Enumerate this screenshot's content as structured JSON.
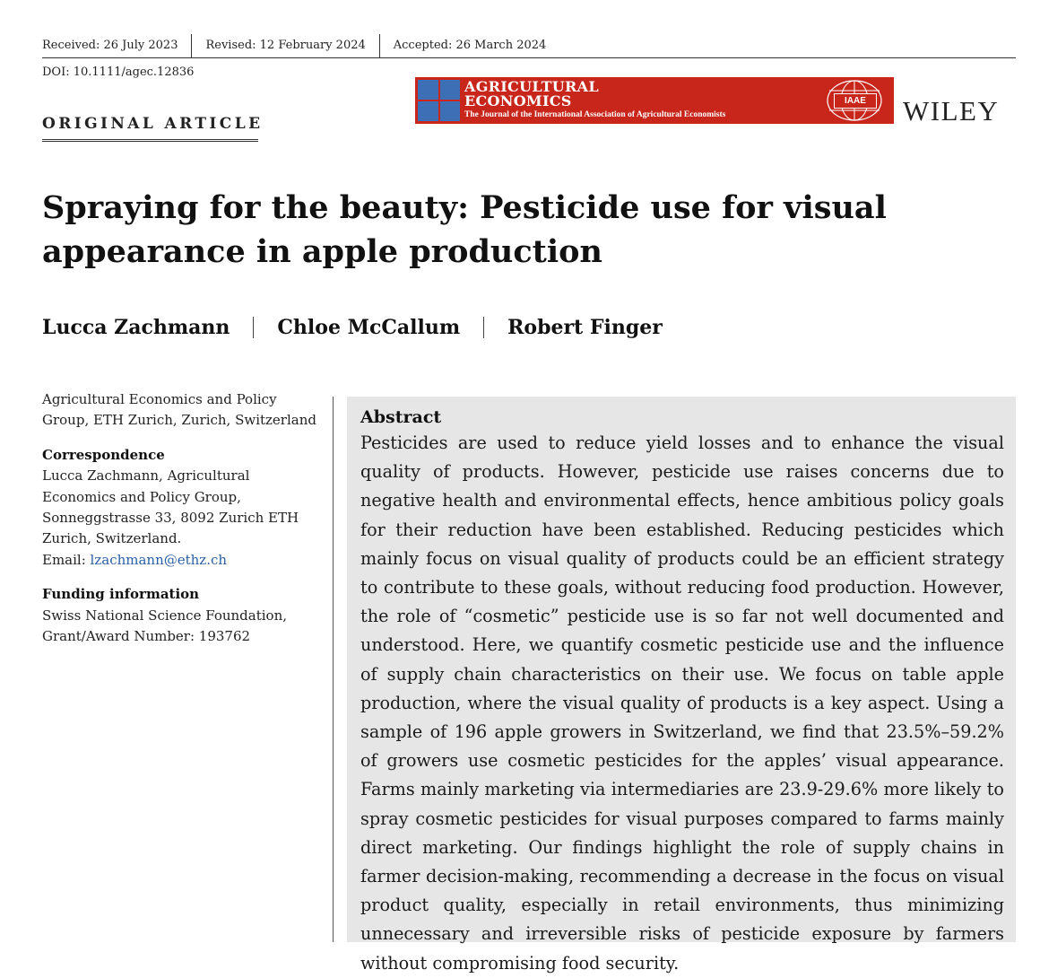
{
  "header": {
    "dates": [
      "Received: 26 July 2023",
      "Revised: 12 February 2024",
      "Accepted: 26 March 2024"
    ],
    "doi": "DOI: 10.1111/agec.12836",
    "article_type": "ORIGINAL ARTICLE"
  },
  "journal": {
    "name_line1": "AGRICULTURAL",
    "name_line2": "ECONOMICS",
    "subtitle": "The Journal of the International Association of Agricultural Economists",
    "badge": "IAAE",
    "publisher": "WILEY",
    "colors": {
      "banner": "#c8251b",
      "logo_squares": "#3c6fb6"
    }
  },
  "title": "Spraying for the beauty: Pesticide use for visual appearance in apple production",
  "authors": [
    "Lucca Zachmann",
    "Chloe McCallum",
    "Robert Finger"
  ],
  "sidebar": {
    "affiliation": "Agricultural Economics and Policy Group, ETH Zurich, Zurich, Switzerland",
    "correspondence_heading": "Correspondence",
    "correspondence_text": "Lucca Zachmann, Agricultural Economics and Policy Group, Sonneggstrasse 33, 8092 Zurich ETH Zurich, Switzerland.",
    "email_label": "Email: ",
    "email": "lzachmann@ethz.ch",
    "funding_heading": "Funding information",
    "funding_text": "Swiss National Science Foundation, Grant/Award Number: 193762"
  },
  "abstract": {
    "heading": "Abstract",
    "text": "Pesticides are used to reduce yield losses and to enhance the visual quality of products. However, pesticide use raises concerns due to negative health and environmental effects, hence ambitious policy goals for their reduction have been established. Reducing pesticides which mainly focus on visual quality of products could be an efficient strategy to contribute to these goals, without reducing food production. However, the role of “cosmetic” pesticide use is so far not well documented and understood. Here, we quantify cosmetic pesticide use and the influence of supply chain characteristics on their use. We focus on table apple production, where the visual quality of products is a key aspect. Using a sample of 196 apple growers in Switzerland, we find that 23.5%–59.2% of growers use cosmetic pesticides for the apples’ visual appearance. Farms mainly marketing via intermediaries are 23.9-29.6% more likely to spray cosmetic pesticides for visual purposes compared to farms mainly direct marketing. Our findings highlight the role of supply chains in farmer decision-making, recommending a decrease in the focus on visual product quality, especially in retail environments, thus minimizing unnecessary and irreversible risks of pesticide exposure by farmers without compromising food security."
  }
}
